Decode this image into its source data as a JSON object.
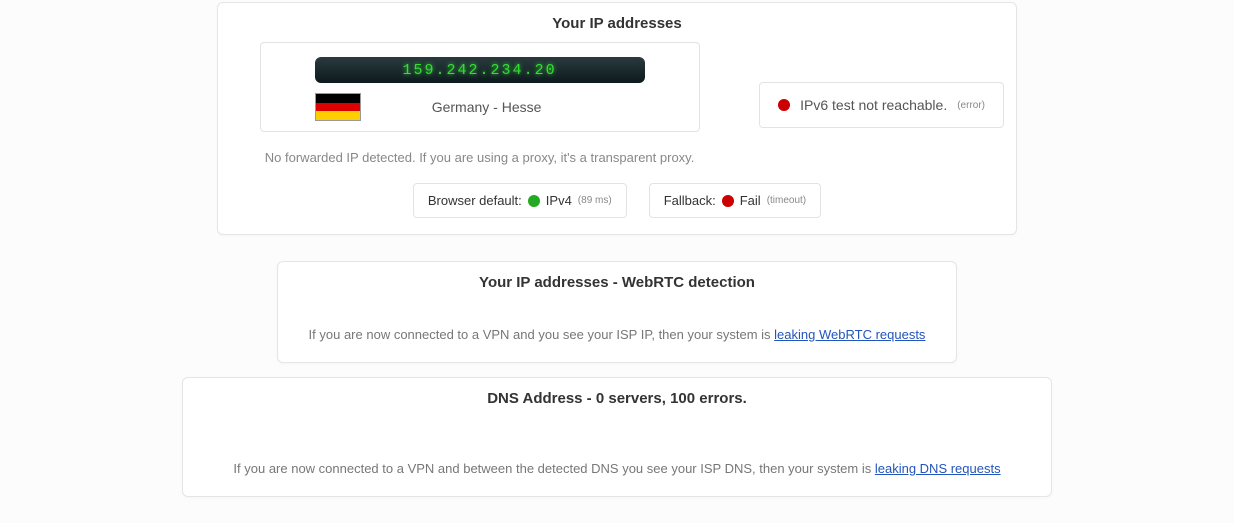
{
  "ip_panel": {
    "title": "Your IP addresses",
    "ipv4_address": "159.242.234.20",
    "location": "Germany - Hesse",
    "forward_note": "No forwarded IP detected. If you are using a proxy, it's a transparent proxy.",
    "ipv6_status": "IPv6 test not reachable.",
    "ipv6_status_note": "(error)",
    "browser_default_label": "Browser default:",
    "browser_default_value": "IPv4",
    "browser_default_timing": "(89 ms)",
    "fallback_label": "Fallback:",
    "fallback_value": "Fail",
    "fallback_note": "(timeout)"
  },
  "webrtc_panel": {
    "title": "Your IP addresses - WebRTC detection",
    "text_prefix": "If you are now connected to a VPN and you see your ISP IP, then your system is ",
    "link_text": "leaking WebRTC requests"
  },
  "dns_panel": {
    "title": "DNS Address - 0 servers, 100 errors.",
    "text_prefix": "If you are now connected to a VPN and between the detected DNS you see your ISP DNS, then your system is ",
    "link_text": "leaking DNS requests"
  }
}
